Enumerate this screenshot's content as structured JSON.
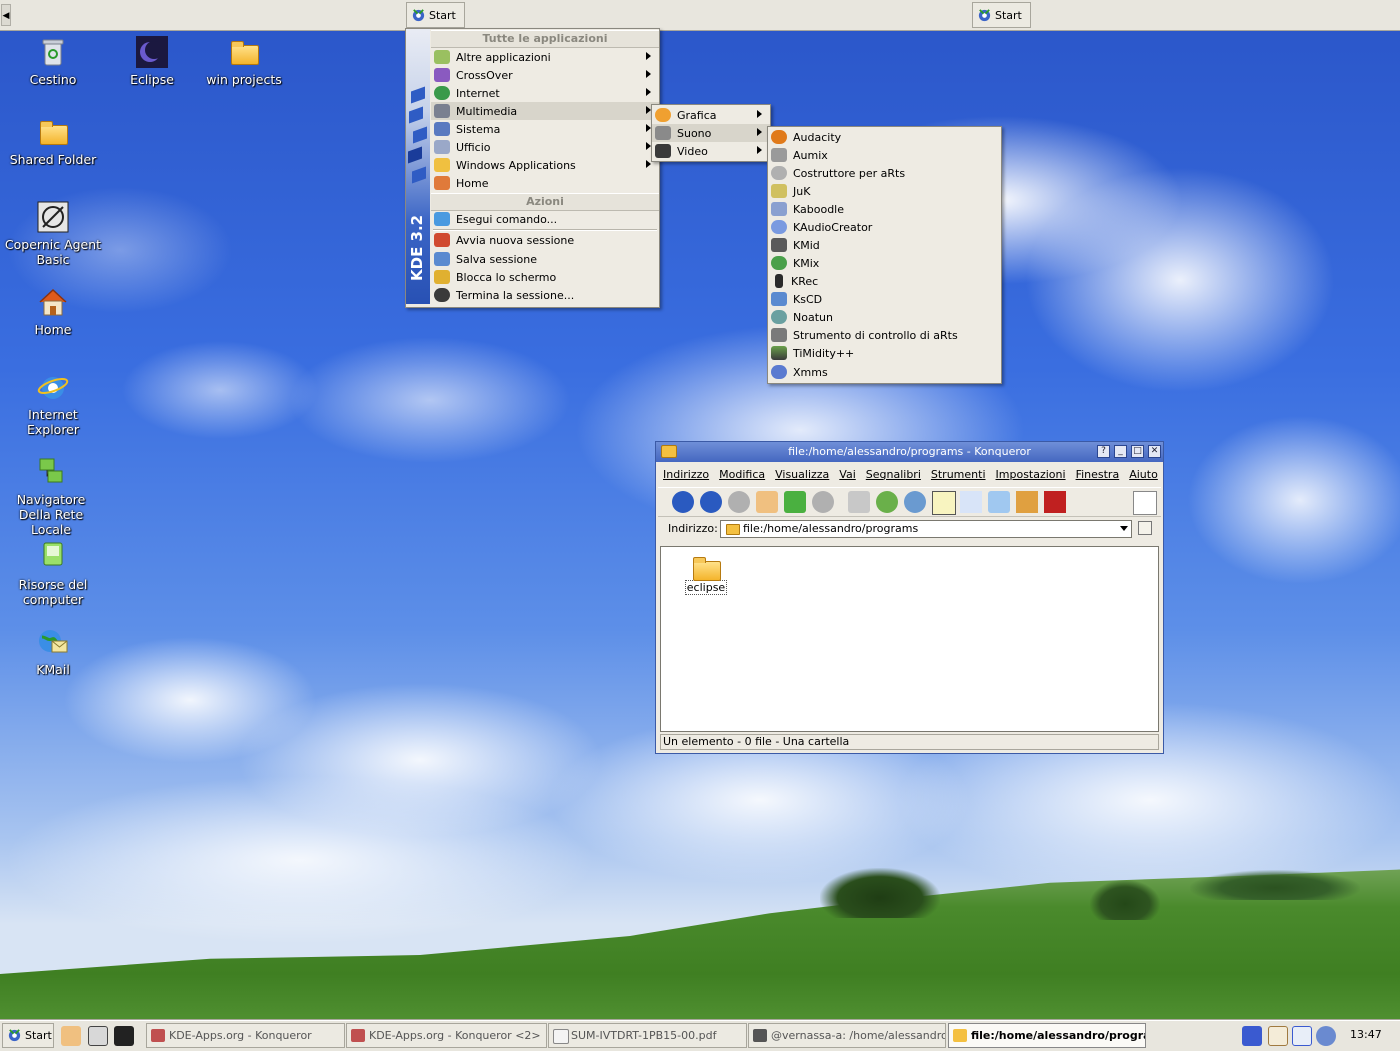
{
  "top_panel": {
    "start_label": "Start",
    "start_label_right": "Start"
  },
  "desktop_icons": [
    {
      "label": "Cestino"
    },
    {
      "label": "Eclipse"
    },
    {
      "label": "win projects"
    },
    {
      "label": "Shared Folder"
    },
    {
      "label": "Copernic Agent Basic"
    },
    {
      "label": "Home"
    },
    {
      "label": "Internet Explorer"
    },
    {
      "label": "Navigatore Della Rete Locale"
    },
    {
      "label": "Risorse del computer"
    },
    {
      "label": "KMail"
    }
  ],
  "kmenu": {
    "version_label": "KDE 3.2",
    "section_apps": "Tutte le applicazioni",
    "items": [
      {
        "label": "Altre applicazioni",
        "submenu": true
      },
      {
        "label": "CrossOver",
        "submenu": true
      },
      {
        "label": "Internet",
        "submenu": true
      },
      {
        "label": "Multimedia",
        "submenu": true
      },
      {
        "label": "Sistema",
        "submenu": true
      },
      {
        "label": "Ufficio",
        "submenu": true
      },
      {
        "label": "Windows Applications",
        "submenu": true
      },
      {
        "label": "Home",
        "submenu": false
      }
    ],
    "section_actions": "Azioni",
    "actions": [
      {
        "label": "Esegui comando..."
      },
      {
        "label": "Avvia nuova sessione"
      },
      {
        "label": "Salva sessione"
      },
      {
        "label": "Blocca lo schermo"
      },
      {
        "label": "Termina la sessione..."
      }
    ]
  },
  "multimedia_menu": {
    "items": [
      {
        "label": "Grafica"
      },
      {
        "label": "Suono"
      },
      {
        "label": "Video"
      }
    ]
  },
  "suono_menu": {
    "items": [
      {
        "label": "Audacity"
      },
      {
        "label": "Aumix"
      },
      {
        "label": "Costruttore per aRts"
      },
      {
        "label": "JuK"
      },
      {
        "label": "Kaboodle"
      },
      {
        "label": "KAudioCreator"
      },
      {
        "label": "KMid"
      },
      {
        "label": "KMix"
      },
      {
        "label": "KRec"
      },
      {
        "label": "KsCD"
      },
      {
        "label": "Noatun"
      },
      {
        "label": "Strumento di controllo di aRts"
      },
      {
        "label": "TiMidity++"
      },
      {
        "label": "Xmms"
      }
    ]
  },
  "konqueror": {
    "title": "file:/home/alessandro/programs - Konqueror",
    "menubar": [
      "Indirizzo",
      "Modifica",
      "Visualizza",
      "Vai",
      "Segnalibri",
      "Strumenti",
      "Impostazioni",
      "Finestra",
      "Aiuto"
    ],
    "address_label": "Indirizzo:",
    "address_value": "file:/home/alessandro/programs",
    "folder_item": "eclipse",
    "status": "Un elemento - 0 file - Una cartella"
  },
  "taskbar": {
    "start_label": "Start",
    "tasks": [
      {
        "label": "KDE-Apps.org - Konqueror",
        "active": false
      },
      {
        "label": "KDE-Apps.org - Konqueror <2>",
        "active": false
      },
      {
        "label": "SUM-IVTDRT-1PB15-00.pdf",
        "active": false
      },
      {
        "label": "@vernassa-a: /home/alessandro",
        "active": false
      },
      {
        "label": "file:/home/alessandro/programs",
        "active": true
      }
    ],
    "clock": "13:47"
  },
  "colors": {
    "title_bar": "#4567c0",
    "menu_bg": "#eeebe3",
    "panel_bg": "#e8e6de"
  }
}
